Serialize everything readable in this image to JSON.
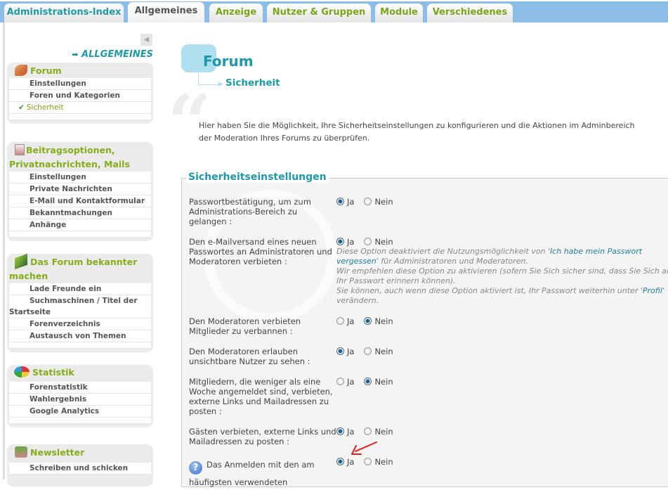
{
  "tabs": [
    {
      "label": "Administrations-Index"
    },
    {
      "label": "Allgemeines",
      "active": true
    },
    {
      "label": "Anzeige"
    },
    {
      "label": "Nutzer & Gruppen"
    },
    {
      "label": "Module"
    },
    {
      "label": "Verschiedenes"
    }
  ],
  "sidebar": {
    "section_heading": "ALLGEMEINES",
    "arrow_glyph": "➡",
    "collapse_glyph": "◀",
    "boxes": [
      {
        "title": "Forum",
        "icon": "wrench-icon",
        "items": [
          "Einstellungen",
          "Foren und Kategorien",
          "Sicherheit"
        ],
        "selected": "Sicherheit"
      },
      {
        "title": "Beitragsoptionen, Privatnachrichten, Mails",
        "icon": "mail-document-icon",
        "items": [
          "Einstellungen",
          "Private Nachrichten",
          "E-Mail und Kontaktformular",
          "Bekanntmachungen",
          "Anhänge"
        ]
      },
      {
        "title": "Das Forum bekannter machen",
        "icon": "growth-arrow-icon",
        "items": [
          "Lade Freunde ein",
          "Suchmaschinen / Titel der Startseite",
          "Forenverzeichnis",
          "Austausch von Themen"
        ]
      },
      {
        "title": "Statistik",
        "icon": "pie-chart-icon",
        "items": [
          "Forenstatistik",
          "Wahlergebnis",
          "Google Analytics"
        ]
      },
      {
        "title": "Newsletter",
        "icon": "newsletter-icon",
        "items": [
          "Schreiben und schicken"
        ]
      }
    ]
  },
  "page": {
    "title": "Forum",
    "subtitle": "Sicherheit",
    "intro_line1": "Hier haben Sie die Möglichkeit, Ihre Sicherheitseinstellungen zu konfigurieren und die Aktionen im Adminbereich",
    "intro_line2": "der Moderation Ihres Forums zu überprüfen."
  },
  "settings": {
    "legend": "Sicherheitseinstellungen",
    "yes": "Ja",
    "no": "Nein",
    "rows": [
      {
        "label": "Passwortbestätigung, um zum Administrations-Bereich zu gelangen :",
        "value": "Ja"
      },
      {
        "label": "Den e-Mailversand eines neuen Passwortes an Administratoren und Moderatoren verbieten :",
        "value": "Ja",
        "help": {
          "p1": "Diese Option deaktiviert die Nutzungsmöglichkeit von '",
          "link1": "Ich habe mein Passwort vergessen",
          "p2": "' für Administratoren und Moderatoren.",
          "p3": "Wir empfehlen diese Option zu aktivieren (sofern Sie Sich sicher sind, dass Sie Sich an Ihr Passwort erinnern können).",
          "p4": "Sie können, auch wenn diese Option aktiviert ist, Ihr Passwort weiterhin unter '",
          "link2": "Profil",
          "p5": "' verändern."
        }
      },
      {
        "label": "Den Moderatoren verbieten Mitglieder zu verbannen :",
        "value": "Nein"
      },
      {
        "label": "Den Moderatoren erlauben unsichtbare Nutzer zu sehen :",
        "value": "Ja"
      },
      {
        "label": "Mitgliedern, die weniger als eine Woche angemeldet sind, verbieten, externe Links und Mailadressen zu posten :",
        "value": "Nein"
      },
      {
        "label": "Gästen verbieten, externe Links und Mailadressen zu posten :",
        "value": "Ja"
      },
      {
        "label": "Das Anmelden mit den am häufigsten verwendeten",
        "value": "Ja",
        "help_icon": "question-icon"
      }
    ]
  },
  "colors": {
    "accent": "#1d9aa8",
    "green": "#86ad1a",
    "tabbar": "#8bbde6",
    "annotation": "#e02020"
  }
}
